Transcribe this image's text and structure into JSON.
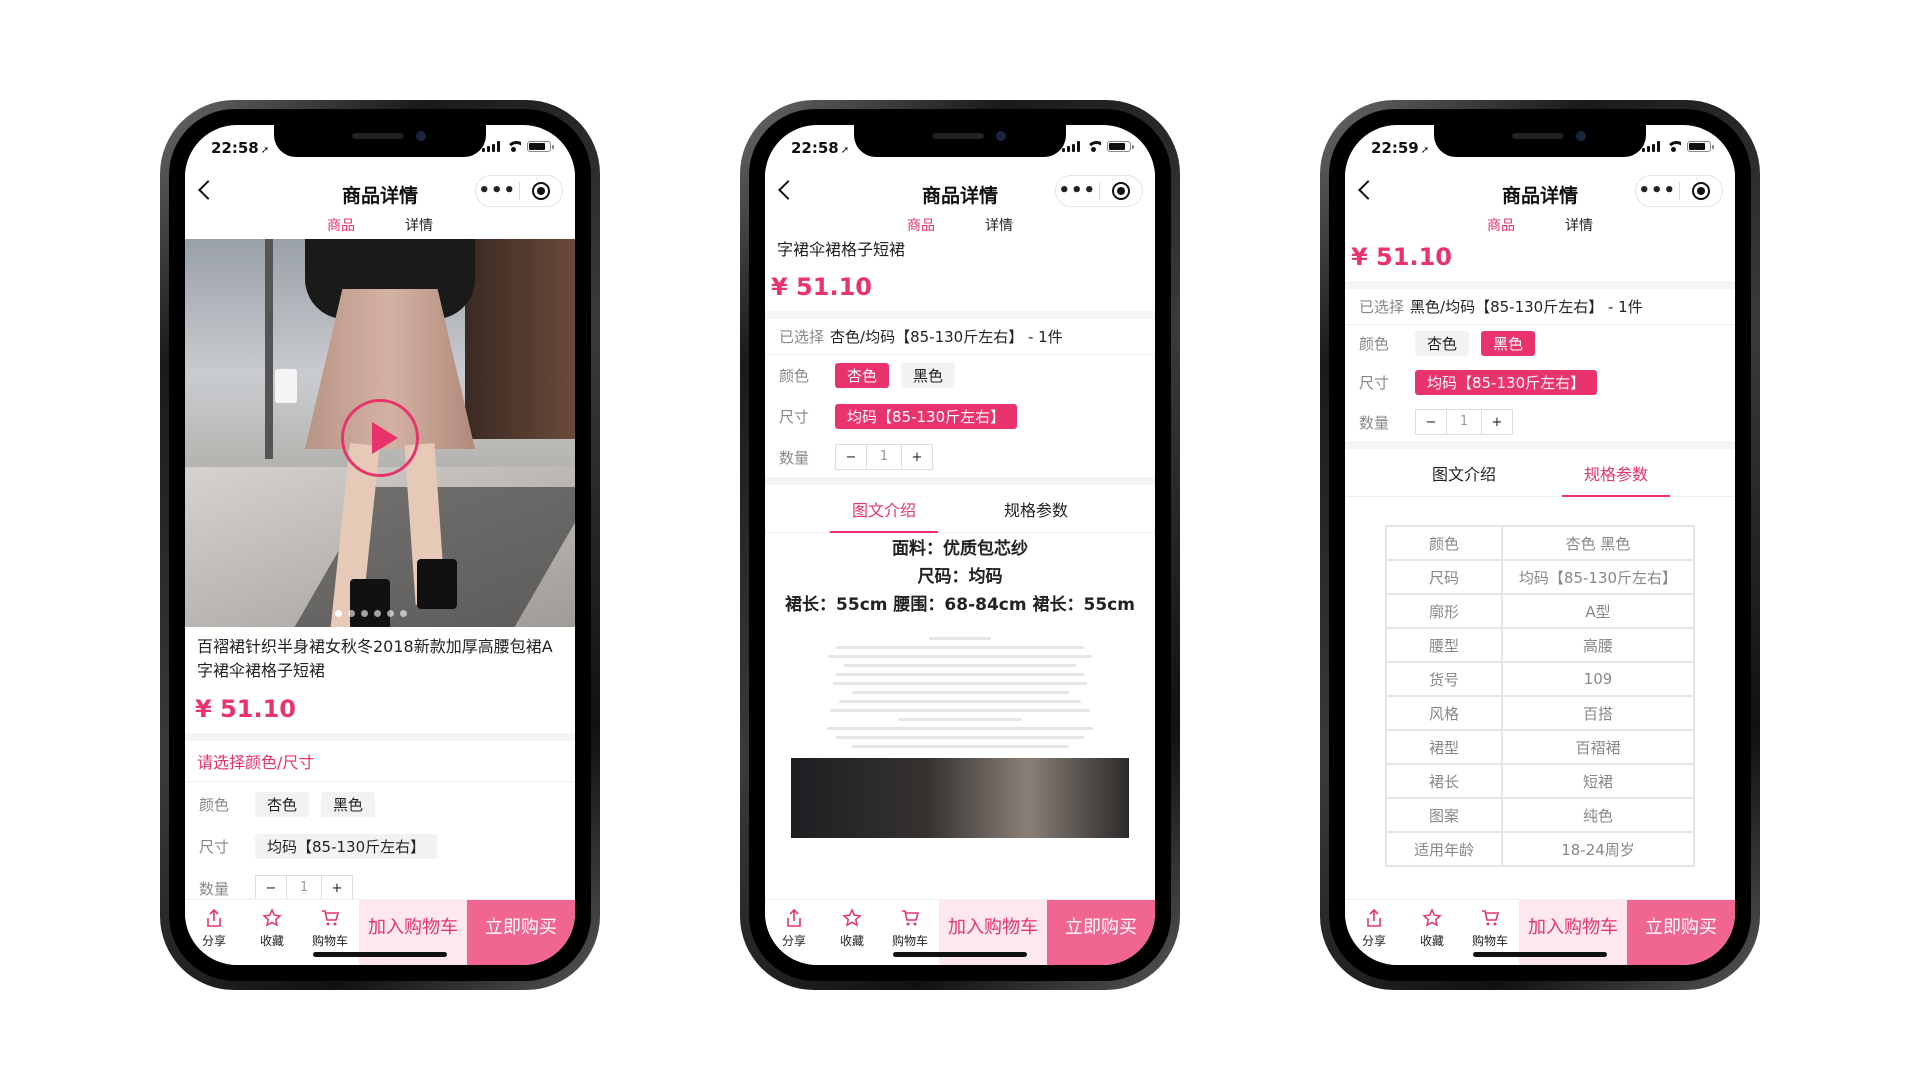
{
  "screens": [
    {
      "time": "22:58",
      "title": "商品详情",
      "tabs": [
        "商品",
        "详情"
      ],
      "active_tab": 0,
      "product_name": "百褶裙针织半身裙女秋冬2018新款加厚高腰包裙A字裙伞裙格子短裙",
      "price": "¥ 51.10",
      "choose_prompt": "请选择颜色/尺寸",
      "color_label": "颜色",
      "colors": [
        "杏色",
        "黑色"
      ],
      "size_label": "尺寸",
      "size": "均码【85-130斤左右】",
      "qty_label": "数量",
      "qty": "1"
    },
    {
      "time": "22:58",
      "title": "商品详情",
      "tabs": [
        "商品",
        "详情"
      ],
      "active_tab": 0,
      "name_tail": "字裙伞裙格子短裙",
      "price": "¥ 51.10",
      "selected_label": "已选择",
      "selected_value": "杏色/均码【85-130斤左右】 - 1件",
      "color_label": "颜色",
      "colors": [
        "杏色",
        "黑色"
      ],
      "size_label": "尺寸",
      "size": "均码【85-130斤左右】",
      "qty_label": "数量",
      "qty": "1",
      "section_tabs": [
        "图文介绍",
        "规格参数"
      ],
      "detail_lines": [
        "面料：优质包芯纱",
        "尺码：均码",
        "裙长：55cm 腰围：68-84cm 裙长：55cm"
      ]
    },
    {
      "time": "22:59",
      "title": "商品详情",
      "tabs": [
        "商品",
        "详情"
      ],
      "active_tab": 0,
      "price": "¥ 51.10",
      "selected_label": "已选择",
      "selected_value": "黑色/均码【85-130斤左右】 - 1件",
      "color_label": "颜色",
      "colors": [
        "杏色",
        "黑色"
      ],
      "size_label": "尺寸",
      "size": "均码【85-130斤左右】",
      "qty_label": "数量",
      "qty": "1",
      "section_tabs": [
        "图文介绍",
        "规格参数"
      ],
      "spec_rows": [
        [
          "颜色",
          "杏色 黑色"
        ],
        [
          "尺码",
          "均码【85-130斤左右】"
        ],
        [
          "廓形",
          "A型"
        ],
        [
          "腰型",
          "高腰"
        ],
        [
          "货号",
          "109"
        ],
        [
          "风格",
          "百搭"
        ],
        [
          "裙型",
          "百褶裙"
        ],
        [
          "裙长",
          "短裙"
        ],
        [
          "图案",
          "纯色"
        ],
        [
          "适用年龄",
          "18-24周岁"
        ]
      ]
    }
  ],
  "bottom_bar": {
    "share": "分享",
    "favorite": "收藏",
    "cart": "购物车",
    "add_to_cart": "加入购物车",
    "buy_now": "立即购买"
  },
  "colors": {
    "accent": "#e8336d",
    "buy": "#f06691",
    "cart_bg": "#fde8ef"
  }
}
